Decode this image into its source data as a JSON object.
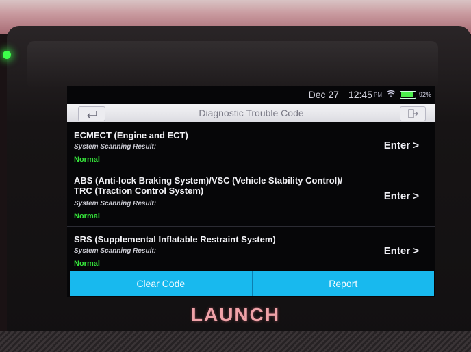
{
  "device": {
    "brand": "LAUNCH"
  },
  "statusbar": {
    "date": "Dec 27",
    "time": "12:45",
    "ampm": "PM",
    "battery_pct": "92%"
  },
  "titlebar": {
    "title": "Diagnostic Trouble Code"
  },
  "systems": [
    {
      "name": "ECMECT (Engine and ECT)",
      "label": "System Scanning Result:",
      "status": "Normal",
      "action": "Enter >"
    },
    {
      "name": "ABS (Anti-lock Braking System)/VSC (Vehicle Stability Control)/ TRC (Traction Control System)",
      "label": "System Scanning Result:",
      "status": "Normal",
      "action": "Enter >"
    },
    {
      "name": "SRS (Supplemental Inflatable Restraint System)",
      "label": "System Scanning Result:",
      "status": "Normal",
      "action": "Enter >"
    }
  ],
  "actions": {
    "clear_code": "Clear Code",
    "report": "Report"
  },
  "colors": {
    "accent": "#18b9ee",
    "status_normal": "#35e23a",
    "led": "#3cff4a",
    "brand": "#f0a2a8"
  }
}
